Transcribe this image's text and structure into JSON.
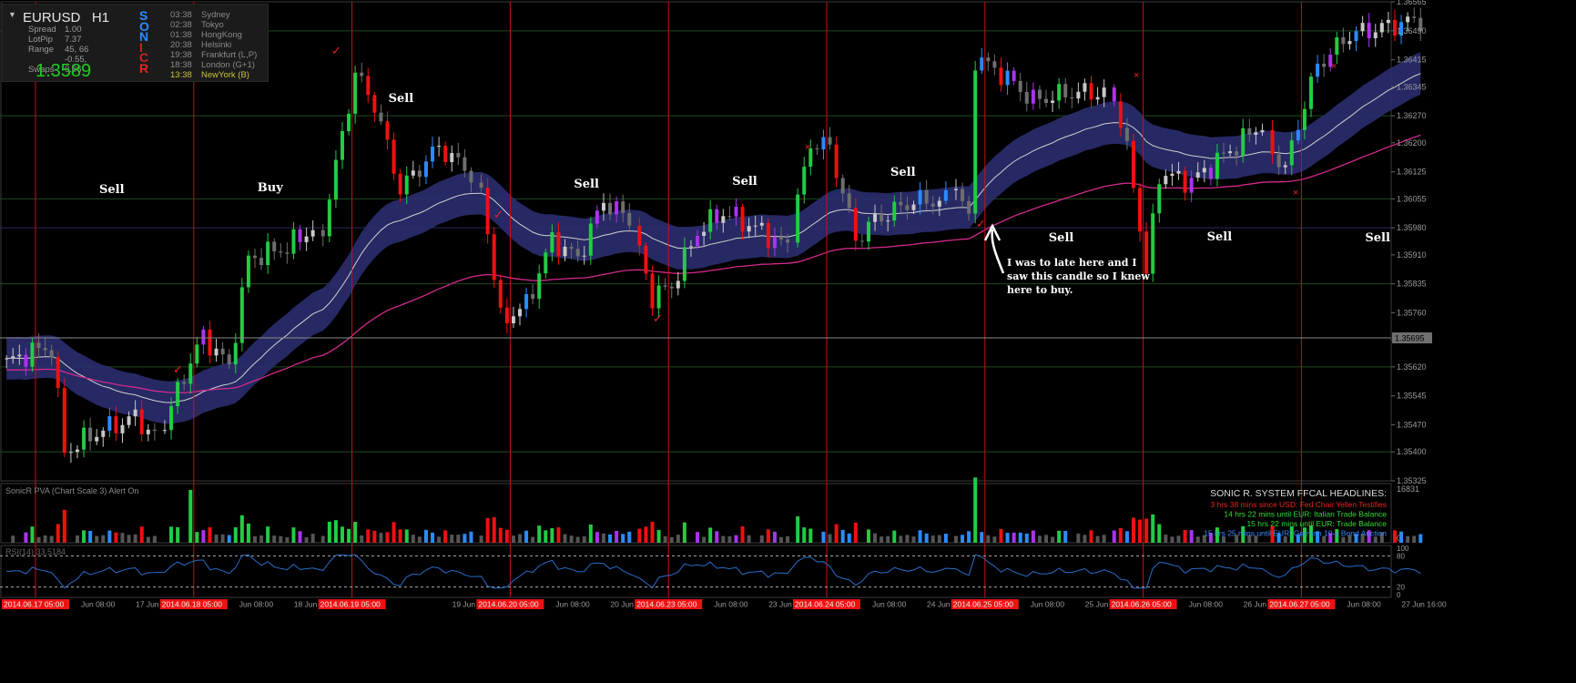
{
  "info_panel": {
    "symbol": "EURUSD",
    "timeframe": "H1",
    "stats": [
      {
        "label": "Spread",
        "value": "1.00"
      },
      {
        "label": "LotPip",
        "value": "7.37"
      },
      {
        "label": "Range",
        "value": "45, 66"
      },
      {
        "label": "Swaps",
        "value": "-0.55, 0.06"
      }
    ],
    "price": "1.3589",
    "sonic_letters": [
      {
        "ch": "S",
        "color": "#2a8cff"
      },
      {
        "ch": "O",
        "color": "#2a8cff"
      },
      {
        "ch": "N",
        "color": "#2a8cff"
      },
      {
        "ch": "I",
        "color": "#cc2222"
      },
      {
        "ch": "C",
        "color": "#cc2222"
      },
      {
        "ch": "R",
        "color": "#ee2222"
      }
    ],
    "sessions": [
      {
        "time": "03:38",
        "name": "Sydney",
        "color": "#8a8a8a"
      },
      {
        "time": "02:38",
        "name": "Tokyo",
        "color": "#8a8a8a"
      },
      {
        "time": "01:38",
        "name": "HongKong",
        "color": "#8a8a8a"
      },
      {
        "time": "20:38",
        "name": "Helsinki",
        "color": "#8a8a8a"
      },
      {
        "time": "19:38",
        "name": "Frankfurt (L,P)",
        "color": "#8a8a8a"
      },
      {
        "time": "18:38",
        "name": "London (G+1)",
        "color": "#8a8a8a"
      },
      {
        "time": "13:38",
        "name": "NewYork (B)",
        "color": "#c9c23a"
      }
    ]
  },
  "price_axis_labels": [
    "1.36565",
    "1.36490",
    "1.36415",
    "1.36345",
    "1.36270",
    "1.36200",
    "1.36125",
    "1.36055",
    "1.35980",
    "1.35910",
    "1.35835",
    "1.35760",
    "1.35690",
    "1.35620",
    "1.35545",
    "1.35470",
    "1.35400",
    "1.35325"
  ],
  "current_price_label": "1.35695",
  "annotations": {
    "signals": [
      {
        "text": "Sell",
        "date": "2014.06.17",
        "hour": 3
      },
      {
        "text": "Buy",
        "date": "2014.06.18",
        "hour": 2
      },
      {
        "text": "Sell",
        "date": "2014.06.19",
        "hour": 2
      },
      {
        "text": "Sell",
        "date": "2014.06.20",
        "hour": 2
      },
      {
        "text": "Sell",
        "date": "2014.06.23",
        "hour": 2
      },
      {
        "text": "Sell",
        "date": "2014.06.24",
        "hour": 2
      },
      {
        "text": "Sell",
        "date": "2014.06.25",
        "hour": 2
      },
      {
        "text": "Sell",
        "date": "2014.06.26",
        "hour": 2
      },
      {
        "text": "Sell",
        "date": "2014.06.27",
        "hour": 2
      }
    ],
    "note_lines": [
      "I was to late here and I",
      "saw this candle so I knew",
      "here to buy."
    ]
  },
  "volume_panel": {
    "title": "SonicR PVA  (Chart Scale 3)   Alert On",
    "scale_top": "16831",
    "scale_bottom": "0",
    "headlines_title": "SONIC R. SYSTEM   FFCAL HEADLINES:",
    "headlines": [
      {
        "text": "3 hrs 38 mins since USD: Fed Chair Yellen Testifies",
        "color": "#ee2222"
      },
      {
        "text": "14 hrs 22 mins until EUR: Italian Trade Balance",
        "color": "#33dd33"
      },
      {
        "text": "15 hrs 22 mins until EUR: Trade Balance",
        "color": "#33dd33"
      },
      {
        "text": "15 hrs 25 mins until EUR: German 10-y Bond Auction",
        "color": "#3a8cff"
      }
    ]
  },
  "rsi_panel": {
    "title": "RSI(14) 33.5184",
    "levels": [
      "100",
      "80",
      "20",
      "0"
    ]
  },
  "time_axis": {
    "labels": [
      {
        "text": "2014.06.17 05:00",
        "highlight": true
      },
      {
        "text": "Jun 08:00",
        "highlight": false
      },
      {
        "text": "17 Jun 16:00",
        "highlight": false
      },
      {
        "text": "2014.06.18 05:00",
        "highlight": true
      },
      {
        "text": "Jun 08:00",
        "highlight": false
      },
      {
        "text": "18 Jun 16:00",
        "highlight": false
      },
      {
        "text": "2014.06.19 05:00",
        "highlight": true
      },
      {
        "text": "19 Jun 16:00",
        "highlight": false
      },
      {
        "text": "2014.06.20 05:00",
        "highlight": true
      },
      {
        "text": "Jun 08:00",
        "highlight": false
      },
      {
        "text": "20 Jun 16:00",
        "highlight": false
      },
      {
        "text": "2014.06.23 05:00",
        "highlight": true
      },
      {
        "text": "Jun 08:00",
        "highlight": false
      },
      {
        "text": "23 Jun 16:00",
        "highlight": false
      },
      {
        "text": "2014.06.24 05:00",
        "highlight": true
      },
      {
        "text": "Jun 08:00",
        "highlight": false
      },
      {
        "text": "24 Jun 16:00",
        "highlight": false
      },
      {
        "text": "2014.06.25 05:00",
        "highlight": true
      },
      {
        "text": "Jun 08:00",
        "highlight": false
      },
      {
        "text": "25 Jun 16:00",
        "highlight": false
      },
      {
        "text": "2014.06.26 05:00",
        "highlight": true
      },
      {
        "text": "Jun 08:00",
        "highlight": false
      },
      {
        "text": "26 Jun 16:00",
        "highlight": false
      },
      {
        "text": "2014.06.27 05:00",
        "highlight": true
      },
      {
        "text": "Jun 08:00",
        "highlight": false
      },
      {
        "text": "27 Jun 16:00",
        "highlight": false
      }
    ]
  },
  "colors": {
    "background": "#000000",
    "bull": "#c8c8c8",
    "bull_volume": "#22cc44",
    "bear_volume": "#ee1111",
    "climax_up": "#22cc44",
    "climax_down": "#ee1111",
    "neutral_high": "#aa33ee",
    "neutral_up": "#2a8cff",
    "dragon_band": "#2a2e6e",
    "ema": "#d02a8c",
    "rsi": "#2a6cc8",
    "session_line": "#cc1111",
    "grid_green": "#1e4a1e"
  },
  "chart_data": {
    "type": "candlestick",
    "symbol": "EURUSD",
    "timeframe": "H1",
    "ylim": [
      1.35325,
      1.36565
    ],
    "days": [
      "2014.06.17",
      "2014.06.18",
      "2014.06.19",
      "2014.06.20",
      "2014.06.23",
      "2014.06.24",
      "2014.06.25",
      "2014.06.26",
      "2014.06.27"
    ],
    "daily_keypoints": [
      {
        "date": "2014.06.17",
        "hours": [
          [
            0,
            1.3563
          ],
          [
            4,
            1.3566
          ],
          [
            7,
            1.3567
          ],
          [
            9,
            1.354
          ],
          [
            14,
            1.3545
          ],
          [
            20,
            1.3549
          ],
          [
            23,
            1.3544
          ]
        ]
      },
      {
        "date": "2014.06.18",
        "hours": [
          [
            0,
            1.3547
          ],
          [
            3,
            1.356
          ],
          [
            6,
            1.357
          ],
          [
            10,
            1.3562
          ],
          [
            13,
            1.359
          ],
          [
            19,
            1.3593
          ],
          [
            23,
            1.3598
          ]
        ]
      },
      {
        "date": "2014.06.19",
        "hours": [
          [
            0,
            1.3598
          ],
          [
            3,
            1.3622
          ],
          [
            5,
            1.3638
          ],
          [
            8,
            1.363
          ],
          [
            12,
            1.3608
          ],
          [
            18,
            1.3619
          ],
          [
            23,
            1.3612
          ]
        ]
      },
      {
        "date": "2014.06.20",
        "hours": [
          [
            0,
            1.3609
          ],
          [
            3,
            1.3574
          ],
          [
            7,
            1.3578
          ],
          [
            11,
            1.3595
          ],
          [
            15,
            1.359
          ],
          [
            19,
            1.3605
          ],
          [
            23,
            1.36
          ]
        ]
      },
      {
        "date": "2014.06.23",
        "hours": [
          [
            0,
            1.3592
          ],
          [
            2,
            1.358
          ],
          [
            5,
            1.3583
          ],
          [
            9,
            1.3597
          ],
          [
            13,
            1.3602
          ],
          [
            18,
            1.3598
          ],
          [
            23,
            1.3593
          ]
        ]
      },
      {
        "date": "2014.06.24",
        "hours": [
          [
            0,
            1.3605
          ],
          [
            2,
            1.362
          ],
          [
            5,
            1.3619
          ],
          [
            9,
            1.3595
          ],
          [
            12,
            1.36
          ],
          [
            18,
            1.3605
          ],
          [
            23,
            1.3605
          ]
        ]
      },
      {
        "date": "2014.06.25",
        "hours": [
          [
            0,
            1.3608
          ],
          [
            2,
            1.36
          ],
          [
            3,
            1.3642
          ],
          [
            7,
            1.3638
          ],
          [
            12,
            1.3631
          ],
          [
            18,
            1.3633
          ],
          [
            23,
            1.3633
          ]
        ]
      },
      {
        "date": "2014.06.26",
        "hours": [
          [
            0,
            1.3632
          ],
          [
            3,
            1.361
          ],
          [
            5,
            1.3586
          ],
          [
            7,
            1.3612
          ],
          [
            12,
            1.361
          ],
          [
            18,
            1.3618
          ],
          [
            23,
            1.3625
          ]
        ]
      },
      {
        "date": "2014.06.27",
        "hours": [
          [
            0,
            1.3618
          ],
          [
            2,
            1.3613
          ],
          [
            4,
            1.3625
          ],
          [
            7,
            1.364
          ],
          [
            12,
            1.3648
          ],
          [
            23,
            1.3652
          ]
        ]
      }
    ],
    "signals": "see annotations.signals",
    "volume_max": 16831,
    "rsi_last": 33.5184,
    "rsi_levels": [
      20,
      80
    ]
  }
}
